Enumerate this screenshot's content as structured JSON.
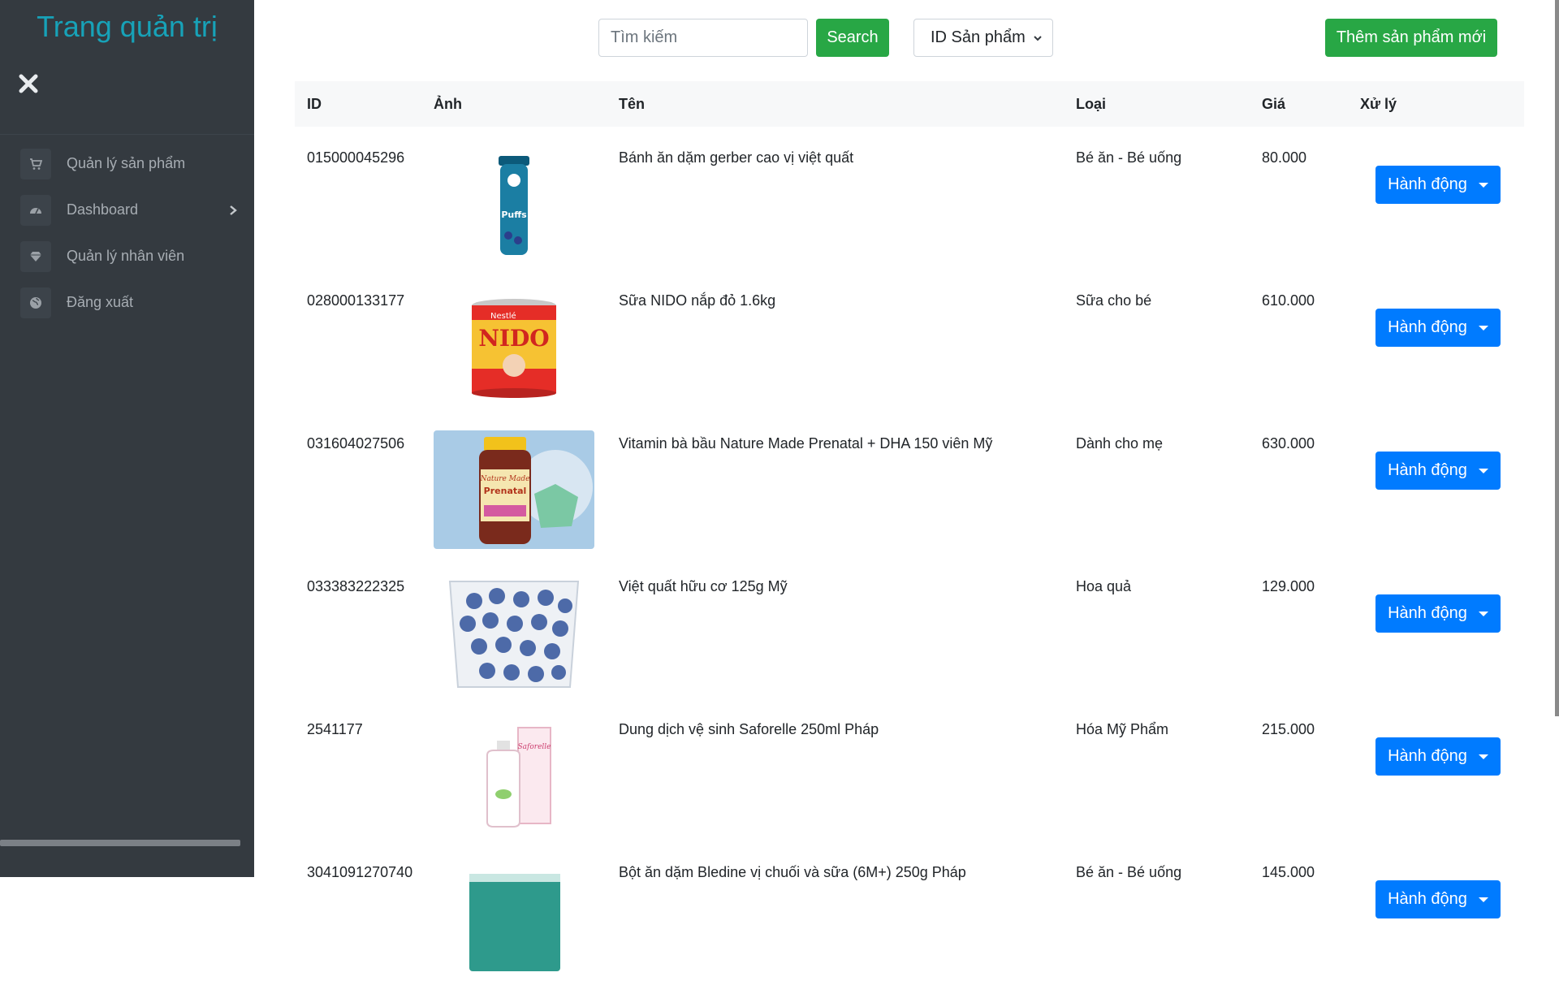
{
  "brand": {
    "title": "Trang quản trị"
  },
  "sidebar": {
    "items": [
      {
        "label": "Quản lý sản phẩm",
        "icon": "cart-icon"
      },
      {
        "label": "Dashboard",
        "icon": "dashboard-icon"
      },
      {
        "label": "Quản lý nhân viên",
        "icon": "diamond-icon"
      },
      {
        "label": "Đăng xuất",
        "icon": "globe-icon"
      }
    ]
  },
  "toolbar": {
    "search_placeholder": "Tìm kiếm",
    "search_label": "Search",
    "filter_value": "ID Sản phẩm",
    "add_label": "Thêm sản phẩm mới"
  },
  "table": {
    "headers": [
      "ID",
      "Ảnh",
      "Tên",
      "Loại",
      "Giá",
      "Xử lý"
    ],
    "action_label": "Hành động",
    "rows": [
      {
        "id": "015000045296",
        "name": "Bánh ăn dặm gerber cao vị việt quất",
        "category": "Bé ăn - Bé uống",
        "price": "80.000"
      },
      {
        "id": "028000133177",
        "name": "Sữa NIDO nắp đỏ 1.6kg",
        "category": "Sữa cho bé",
        "price": "610.000"
      },
      {
        "id": "031604027506",
        "name": "Vitamin bà bầu Nature Made Prenatal + DHA 150 viên Mỹ",
        "category": "Dành cho mẹ",
        "price": "630.000"
      },
      {
        "id": "033383222325",
        "name": "Việt quất hữu cơ 125g Mỹ",
        "category": "Hoa quả",
        "price": "129.000"
      },
      {
        "id": "2541177",
        "name": "Dung dịch vệ sinh Saforelle 250ml Pháp",
        "category": "Hóa Mỹ Phẩm",
        "price": "215.000"
      },
      {
        "id": "3041091270740",
        "name": "Bột ăn dặm Bledine vị chuối và sữa (6M+) 250g Pháp",
        "category": "Bé ăn - Bé uống",
        "price": "145.000"
      }
    ]
  },
  "product_images": {
    "row0_brand": "Puffs",
    "row1_brand": "Nestlé",
    "row1_product": "NIDO",
    "row2_brand": "Nature Made",
    "row2_product": "Prenatal",
    "row4_brand": "Saforelle"
  },
  "colors": {
    "sidebar": "#343a40",
    "brand": "#17a2b8",
    "success": "#28a745",
    "primary": "#007bff"
  }
}
